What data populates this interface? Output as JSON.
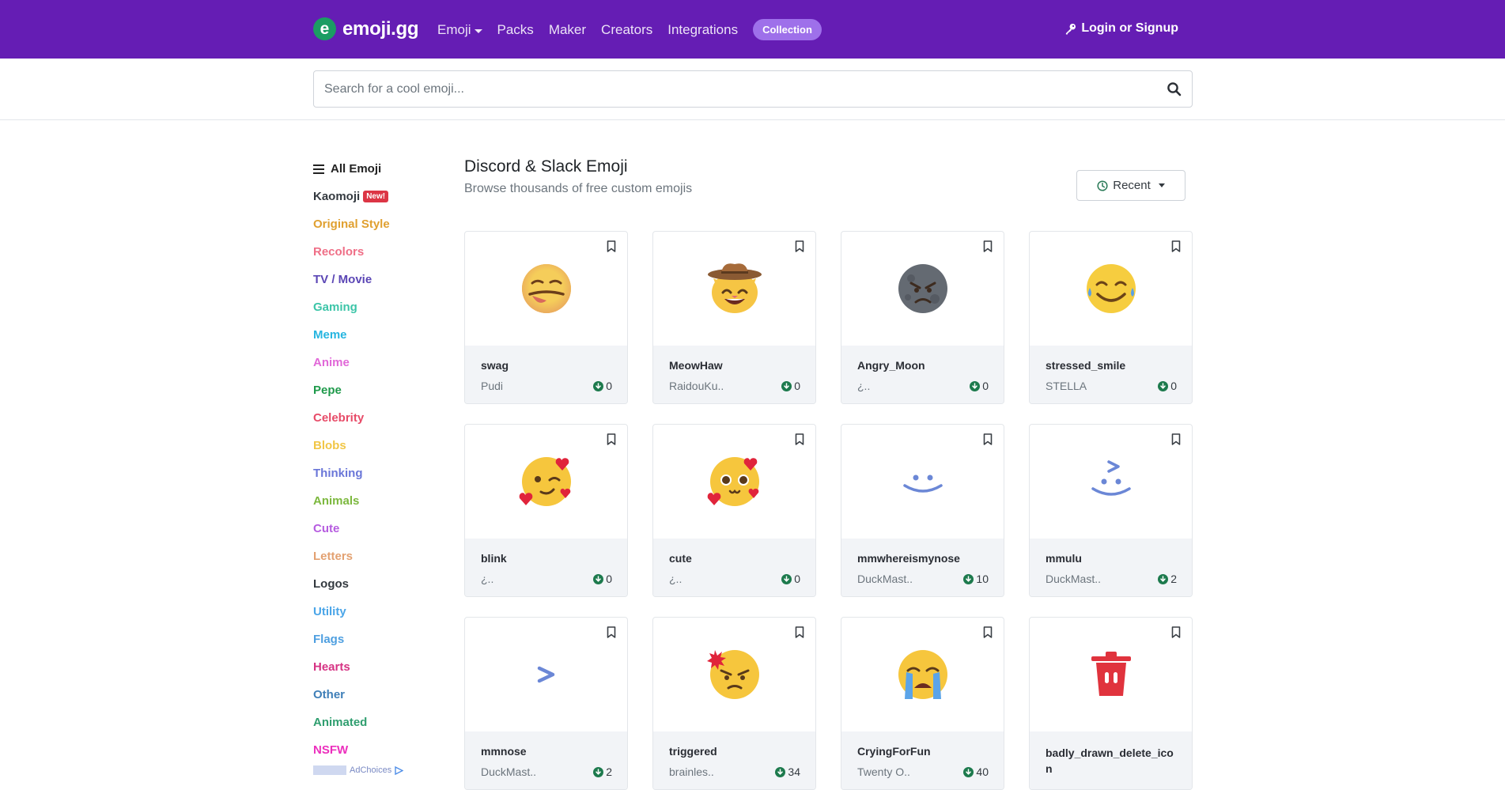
{
  "nav": {
    "brand_letter": "e",
    "brand_name": "emoji.gg",
    "links": [
      "Emoji",
      "Packs",
      "Maker",
      "Creators",
      "Integrations"
    ],
    "collection": "Collection",
    "login": "Login or Signup"
  },
  "search": {
    "placeholder": "Search for a cool emoji..."
  },
  "sidebar": {
    "all": "All Emoji",
    "new_badge": "New!",
    "items": [
      {
        "label": "Kaomoji",
        "color": "#343a40"
      },
      {
        "label": "Original Style",
        "color": "#e0a030"
      },
      {
        "label": "Recolors",
        "color": "#ef6f87"
      },
      {
        "label": "TV / Movie",
        "color": "#5b46b5"
      },
      {
        "label": "Gaming",
        "color": "#3cc5a8"
      },
      {
        "label": "Meme",
        "color": "#26b5e0"
      },
      {
        "label": "Anime",
        "color": "#e168d8"
      },
      {
        "label": "Pepe",
        "color": "#1f9a4b"
      },
      {
        "label": "Celebrity",
        "color": "#e74b68"
      },
      {
        "label": "Blobs",
        "color": "#f1c646"
      },
      {
        "label": "Thinking",
        "color": "#6a76d8"
      },
      {
        "label": "Animals",
        "color": "#7cb83e"
      },
      {
        "label": "Cute",
        "color": "#b65ce0"
      },
      {
        "label": "Letters",
        "color": "#e3a171"
      },
      {
        "label": "Logos",
        "color": "#343a40"
      },
      {
        "label": "Utility",
        "color": "#4aa5e8"
      },
      {
        "label": "Flags",
        "color": "#4e9fe0"
      },
      {
        "label": "Hearts",
        "color": "#d63384"
      },
      {
        "label": "Other",
        "color": "#3f7fb8"
      },
      {
        "label": "Animated",
        "color": "#2f9e6f"
      },
      {
        "label": "NSFW",
        "color": "#ec2fbd"
      }
    ],
    "ad_choices": "AdChoices"
  },
  "main": {
    "title": "Discord & Slack Emoji",
    "subtitle": "Browse thousands of free custom emojis",
    "sort": "Recent"
  },
  "cards": [
    {
      "name": "swag",
      "author": "Pudi",
      "downloads": "0",
      "icon": "tongue-face-icon"
    },
    {
      "name": "MeowHaw",
      "author": "RaidouKu..",
      "downloads": "0",
      "icon": "cowboy-cat-icon"
    },
    {
      "name": "Angry_Moon",
      "author": "¿..",
      "downloads": "0",
      "icon": "angry-moon-icon"
    },
    {
      "name": "stressed_smile",
      "author": "STELLA",
      "downloads": "0",
      "icon": "sweat-smile-icon"
    },
    {
      "name": "blink",
      "author": "¿..",
      "downloads": "0",
      "icon": "wink-hearts-icon"
    },
    {
      "name": "cute",
      "author": "¿..",
      "downloads": "0",
      "icon": "cute-hearts-icon"
    },
    {
      "name": "mmwhereismynose",
      "author": "DuckMast..",
      "downloads": "10",
      "icon": "dot-face-icon"
    },
    {
      "name": "mmulu",
      "author": "DuckMast..",
      "downloads": "2",
      "icon": "dot-face-arrow-icon"
    },
    {
      "name": "mmnose",
      "author": "DuckMast..",
      "downloads": "2",
      "icon": "nose-arrow-icon"
    },
    {
      "name": "triggered",
      "author": "brainles..",
      "downloads": "34",
      "icon": "triggered-face-icon"
    },
    {
      "name": "CryingForFun",
      "author": "Twenty O..",
      "downloads": "40",
      "icon": "crying-face-icon"
    },
    {
      "name": "badly_drawn_delete_icon",
      "author": "",
      "downloads": "",
      "icon": "trash-can-icon"
    }
  ]
}
